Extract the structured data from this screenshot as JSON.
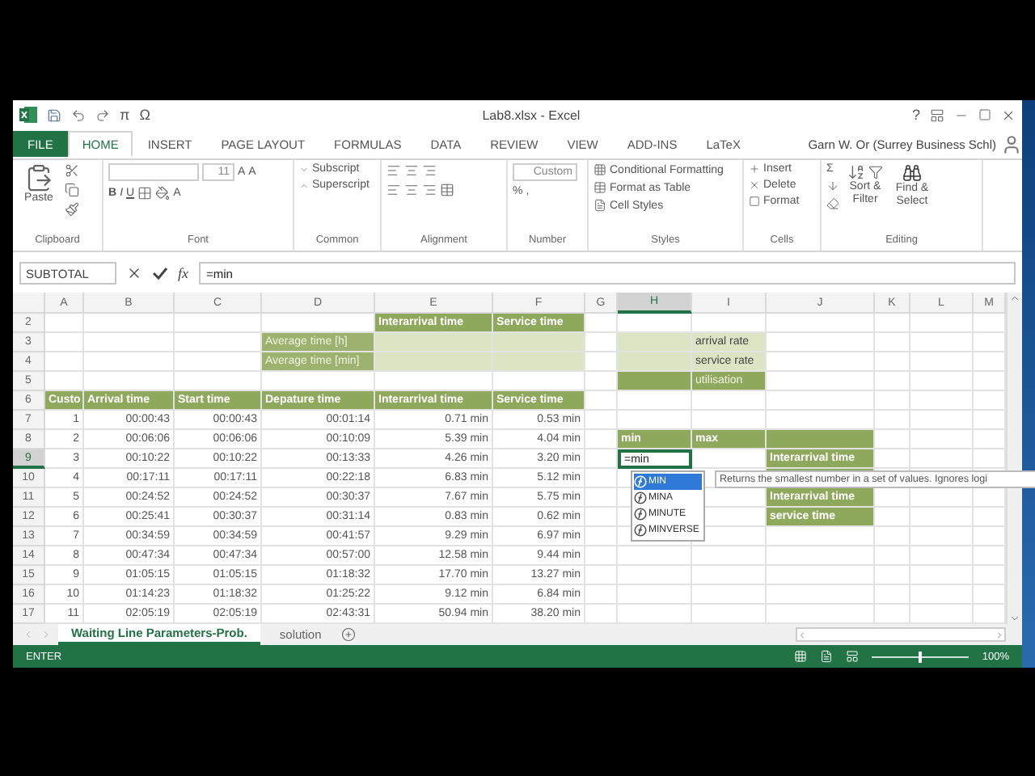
{
  "title_bar": {
    "title": "Lab8.xlsx - Excel",
    "symbols": [
      "π",
      "Ω"
    ],
    "help": "?"
  },
  "ribbon_tabs": [
    {
      "label": "FILE",
      "kind": "file",
      "selected": false
    },
    {
      "label": "HOME",
      "kind": "tab",
      "selected": true
    },
    {
      "label": "INSERT",
      "kind": "tab",
      "selected": false
    },
    {
      "label": "PAGE LAYOUT",
      "kind": "tab",
      "selected": false
    },
    {
      "label": "FORMULAS",
      "kind": "tab",
      "selected": false
    },
    {
      "label": "DATA",
      "kind": "tab",
      "selected": false
    },
    {
      "label": "REVIEW",
      "kind": "tab",
      "selected": false
    },
    {
      "label": "VIEW",
      "kind": "tab",
      "selected": false
    },
    {
      "label": "ADD-INS",
      "kind": "tab",
      "selected": false
    },
    {
      "label": "LaTeX",
      "kind": "tab",
      "selected": false
    }
  ],
  "user": "Garn W. Or (Surrey Business Schl)",
  "ribbon": {
    "clipboard": {
      "paste": "Paste",
      "label": "Clipboard"
    },
    "font": {
      "size": "11",
      "grow": "A",
      "shrink": "A",
      "bold": "B",
      "italic": "I",
      "underline": "U",
      "text_color_button": "A",
      "label": "Font"
    },
    "common": {
      "items": [
        "Subscript",
        "Superscript"
      ],
      "label": "Common"
    },
    "alignment": {
      "label": "Alignment"
    },
    "number": {
      "format": "Custom",
      "percent": "%",
      "comma": ",",
      "label": "Number"
    },
    "styles": {
      "items": [
        "Conditional Formatting",
        "Format as Table",
        "Cell Styles"
      ],
      "label": "Styles"
    },
    "cells": {
      "items": [
        "Insert",
        "Delete",
        "Format"
      ],
      "label": "Cells"
    },
    "editing": {
      "sigma": "Σ",
      "sort": "Sort & Filter",
      "find": "Find & Select",
      "label": "Editing"
    }
  },
  "formula_bar": {
    "name_box": "SUBTOTAL",
    "function_label": "fx",
    "formula": "=min"
  },
  "column_letters": [
    {
      "label": "A",
      "selected": false
    },
    {
      "label": "B",
      "selected": false
    },
    {
      "label": "C",
      "selected": false
    },
    {
      "label": "D",
      "selected": false
    },
    {
      "label": "E",
      "selected": false
    },
    {
      "label": "F",
      "selected": false
    },
    {
      "label": "G",
      "selected": false
    },
    {
      "label": "H",
      "selected": true
    },
    {
      "label": "I",
      "selected": false
    },
    {
      "label": "J",
      "selected": false
    },
    {
      "label": "K",
      "selected": false
    },
    {
      "label": "L",
      "selected": false
    },
    {
      "label": "M",
      "selected": false
    }
  ],
  "row_numbers": [
    {
      "label": "2",
      "selected": false
    },
    {
      "label": "3",
      "selected": false
    },
    {
      "label": "4",
      "selected": false
    },
    {
      "label": "5",
      "selected": false
    },
    {
      "label": "6",
      "selected": false
    },
    {
      "label": "7",
      "selected": false
    },
    {
      "label": "8",
      "selected": false
    },
    {
      "label": "9",
      "selected": true
    },
    {
      "label": "10",
      "selected": false
    },
    {
      "label": "11",
      "selected": false
    },
    {
      "label": "12",
      "selected": false
    },
    {
      "label": "13",
      "selected": false
    },
    {
      "label": "14",
      "selected": false
    },
    {
      "label": "15",
      "selected": false
    },
    {
      "label": "16",
      "selected": false
    },
    {
      "label": "17",
      "selected": false
    }
  ],
  "summary_table": {
    "headers": [
      "Interarrival time",
      "Service time"
    ],
    "row_labels": [
      "Average time [h]",
      "Average time [min]"
    ]
  },
  "rates_table": [
    {
      "label": "arrival rate",
      "kind": "input"
    },
    {
      "label": "service rate",
      "kind": "input"
    },
    {
      "label": "utilisation",
      "kind": "result"
    }
  ],
  "data_table": {
    "columns": [
      "Custo",
      "Arrival time",
      "Start time",
      "Depature time",
      "Interarrival time",
      "Service time"
    ],
    "rows": [
      [
        "1",
        "00:00:43",
        "00:00:43",
        "00:01:14",
        "0.71 min",
        "0.53 min"
      ],
      [
        "2",
        "00:06:06",
        "00:06:06",
        "00:10:09",
        "5.39 min",
        "4.04 min"
      ],
      [
        "3",
        "00:10:22",
        "00:10:22",
        "00:13:33",
        "4.26 min",
        "3.20 min"
      ],
      [
        "4",
        "00:17:11",
        "00:17:11",
        "00:22:18",
        "6.83 min",
        "5.12 min"
      ],
      [
        "5",
        "00:24:52",
        "00:24:52",
        "00:30:37",
        "7.67 min",
        "5.75 min"
      ],
      [
        "6",
        "00:25:41",
        "00:30:37",
        "00:31:14",
        "0.83 min",
        "0.62 min"
      ],
      [
        "7",
        "00:34:59",
        "00:34:59",
        "00:41:57",
        "9.29 min",
        "6.97 min"
      ],
      [
        "8",
        "00:47:34",
        "00:47:34",
        "00:57:00",
        "12.58 min",
        "9.44 min"
      ],
      [
        "9",
        "01:05:15",
        "01:05:15",
        "01:18:32",
        "17.70 min",
        "13.27 min"
      ],
      [
        "10",
        "01:14:23",
        "01:18:32",
        "01:25:22",
        "9.12 min",
        "6.84 min"
      ],
      [
        "11",
        "02:05:19",
        "02:05:19",
        "02:43:31",
        "50.94 min",
        "38.20 min"
      ]
    ]
  },
  "range_block": {
    "headers": [
      "min",
      "max"
    ],
    "active_cell": "=min",
    "labels": [
      "Interarrival time",
      "Interarrival time",
      "service time"
    ]
  },
  "autocomplete": {
    "items": [
      {
        "label": "MIN",
        "selected": true
      },
      {
        "label": "MINA",
        "selected": false
      },
      {
        "label": "MINUTE",
        "selected": false
      },
      {
        "label": "MINVERSE",
        "selected": false
      }
    ],
    "tooltip": "Returns the smallest number in a set of values. Ignores logi"
  },
  "sheet_tabs": [
    {
      "label": "Waiting Line Parameters-Prob.",
      "selected": true
    },
    {
      "label": "solution",
      "selected": false
    }
  ],
  "status_bar": {
    "mode": "ENTER",
    "zoom": "100%",
    "zoom_slider": {
      "level": 0.5
    }
  }
}
